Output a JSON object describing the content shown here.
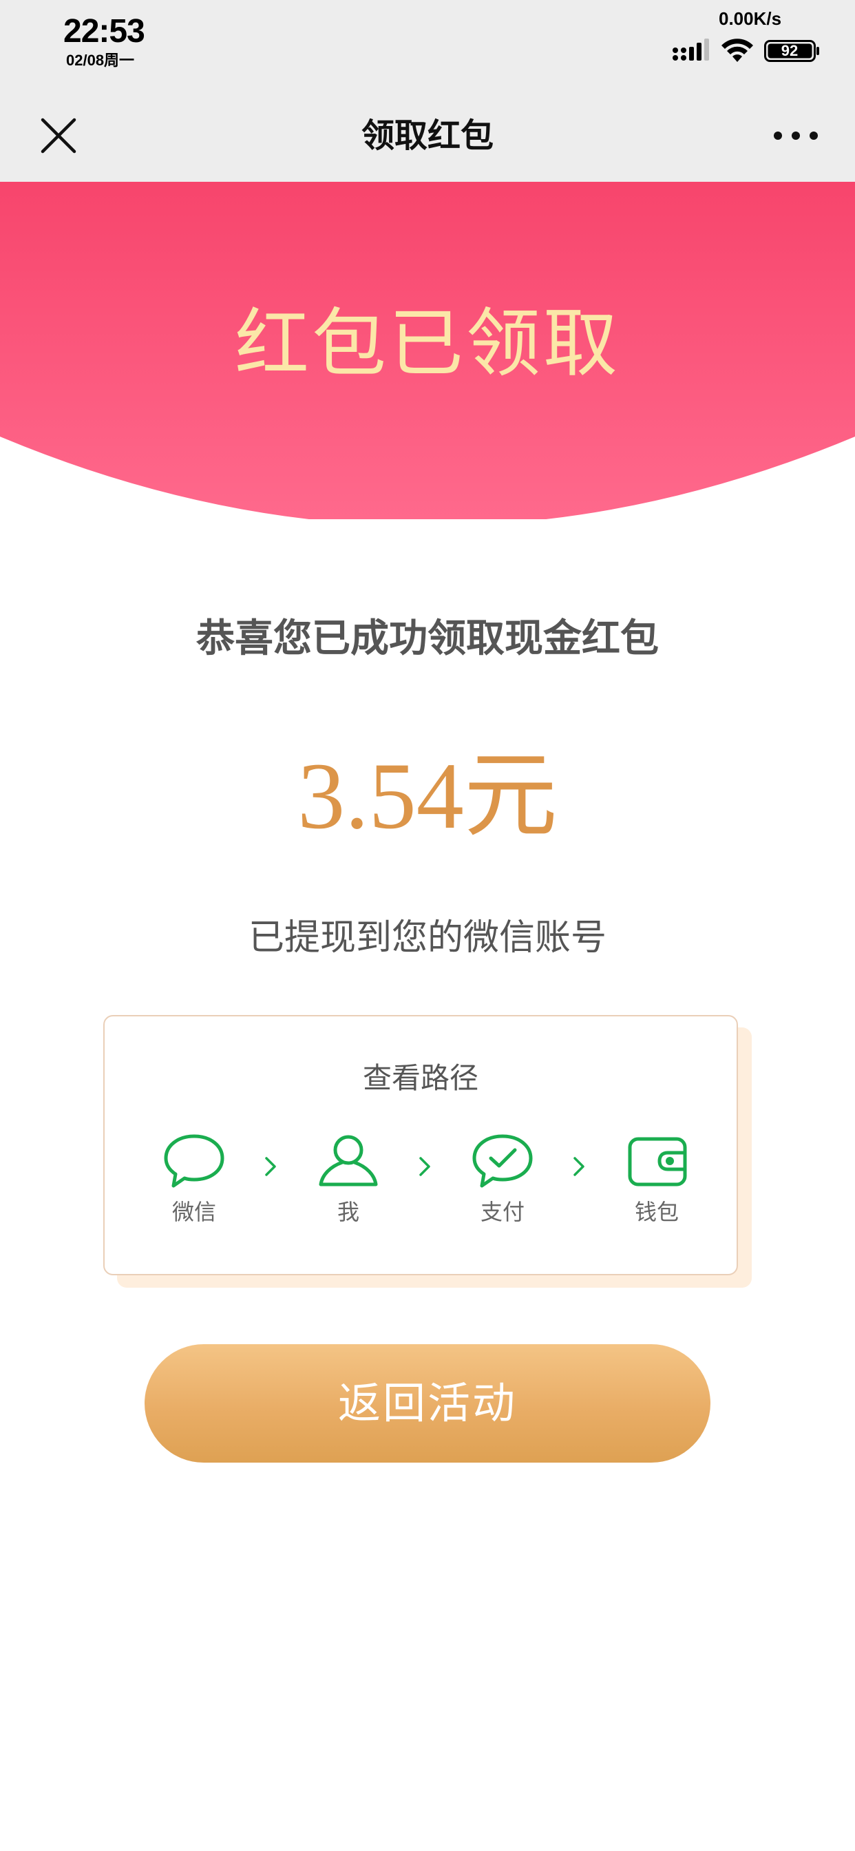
{
  "status_bar": {
    "time": "22:53",
    "date": "02/08周一",
    "network_speed": "0.00K/s",
    "battery": "92",
    "icons": [
      "signal-icon",
      "wifi-icon",
      "battery-icon"
    ]
  },
  "nav": {
    "title": "领取红包",
    "close_icon": "close-icon",
    "more_icon": "more-icon"
  },
  "banner": {
    "title": "红包已领取"
  },
  "main": {
    "congrats_text": "恭喜您已成功领取现金红包",
    "amount_value": "3.54",
    "amount_unit": "元",
    "withdraw_note": "已提现到您的微信账号"
  },
  "path_card": {
    "title": "查看路径",
    "steps": [
      {
        "label": "微信",
        "icon": "chat-bubble-icon"
      },
      {
        "label": "我",
        "icon": "person-icon"
      },
      {
        "label": "支付",
        "icon": "pay-check-icon"
      },
      {
        "label": "钱包",
        "icon": "wallet-icon"
      }
    ]
  },
  "button": {
    "label": "返回活动"
  },
  "colors": {
    "banner_top": "#f7456c",
    "banner_bottom": "#ff6a8d",
    "banner_text": "#fbe7a8",
    "amount": "#dc9549",
    "icon_green": "#1aad4f",
    "button_top": "#f4c485",
    "button_bottom": "#dea153"
  }
}
